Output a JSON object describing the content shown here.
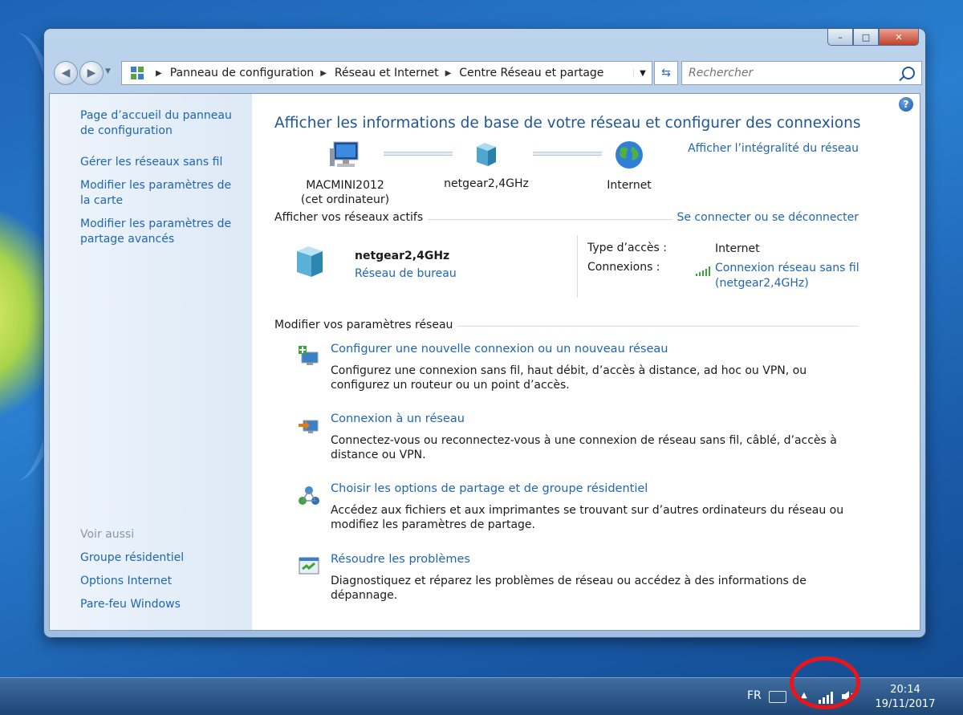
{
  "window": {
    "caption": {
      "minimize": "–",
      "maximize": "□",
      "close": "✕"
    },
    "address": {
      "crumbs": [
        "Panneau de configuration",
        "Réseau et Internet",
        "Centre Réseau et partage"
      ]
    },
    "search": {
      "placeholder": "Rechercher"
    }
  },
  "sidebar": {
    "items": [
      "Page d’accueil du panneau de configuration",
      "Gérer les réseaux sans fil",
      "Modifier les paramètres de la carte",
      "Modifier les paramètres de partage avancés"
    ],
    "see_also_label": "Voir aussi",
    "see_also": [
      "Groupe résidentiel",
      "Options Internet",
      "Pare-feu Windows"
    ]
  },
  "main": {
    "heading": "Afficher les informations de base de votre réseau et configurer des connexions",
    "full_map_link": "Afficher l’intégralité du réseau",
    "map": {
      "computer": {
        "name": "MACMINI2012",
        "sub": "(cet ordinateur)"
      },
      "network": {
        "name": "netgear2,4GHz"
      },
      "internet": {
        "name": "Internet"
      }
    },
    "active": {
      "title": "Afficher vos réseaux actifs",
      "connect_link": "Se connecter ou se déconnecter",
      "name": "netgear2,4GHz",
      "type": "Réseau de bureau",
      "access_label": "Type d’accès :",
      "access_value": "Internet",
      "connections_label": "Connexions :",
      "connections_value_1": "Connexion réseau sans fil",
      "connections_value_2": "(netgear2,4GHz)"
    },
    "change_title": "Modifier vos paramètres réseau",
    "tasks": [
      {
        "link": "Configurer une nouvelle connexion ou un nouveau réseau",
        "desc": "Configurez une connexion sans fil, haut débit, d’accès à distance, ad hoc ou VPN, ou configurez un routeur ou un point d’accès."
      },
      {
        "link": "Connexion à un réseau",
        "desc": "Connectez-vous ou reconnectez-vous à une connexion de réseau sans fil, câblé, d’accès à distance ou VPN."
      },
      {
        "link": "Choisir les options de partage et de groupe résidentiel",
        "desc": "Accédez aux fichiers et aux imprimantes se trouvant sur d’autres ordinateurs du réseau ou modifiez les paramètres de partage."
      },
      {
        "link": "Résoudre les problèmes",
        "desc": "Diagnostiquez et réparez les problèmes de réseau ou accédez à des informations de dépannage."
      }
    ]
  },
  "taskbar": {
    "lang": "FR",
    "time": "20:14",
    "date": "19/11/2017"
  },
  "colors": {
    "link": "#1e66b4",
    "heading": "#1e5697",
    "annotation": "#e8161a"
  }
}
